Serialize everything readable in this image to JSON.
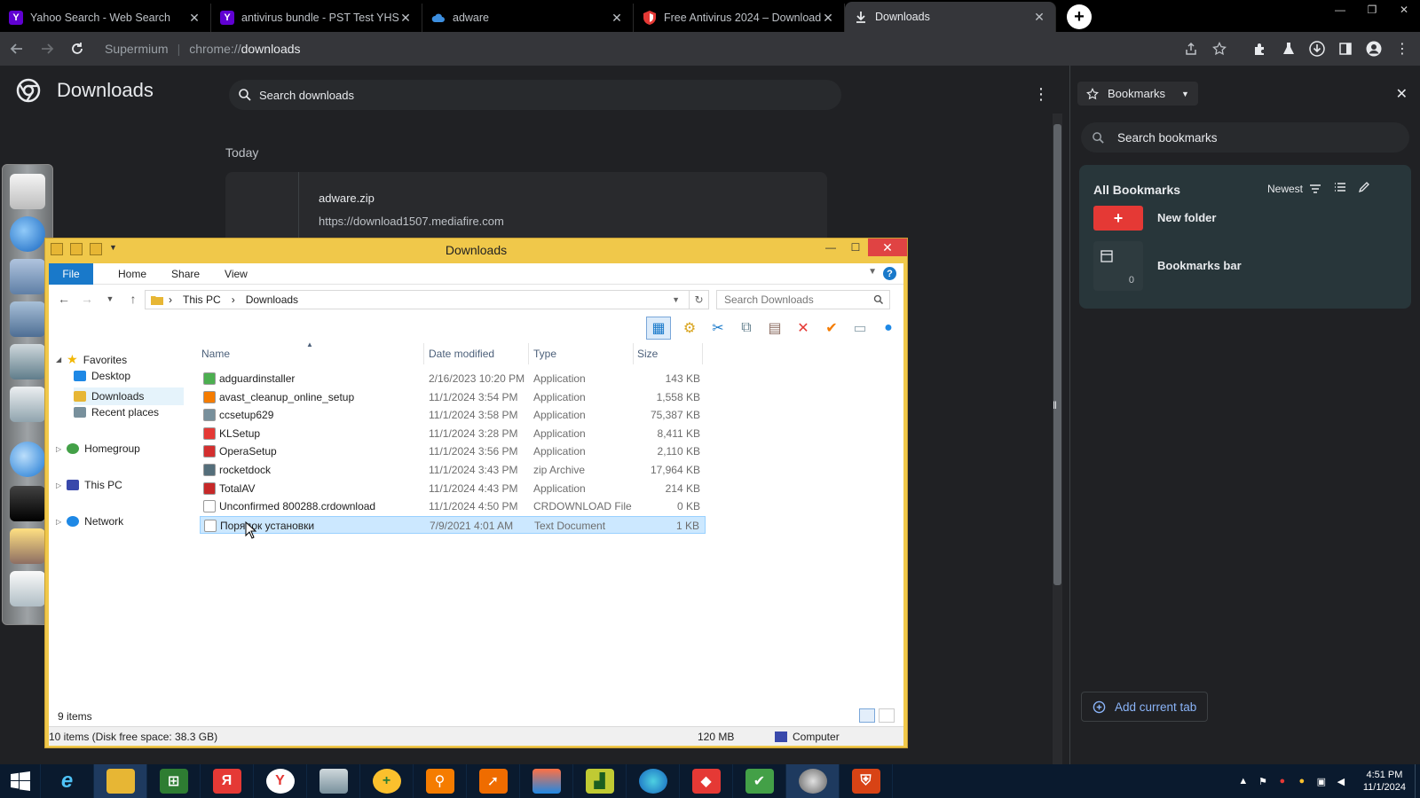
{
  "browser": {
    "tabs": [
      {
        "title": "Yahoo Search - Web Search",
        "favicon_color": "#6001d2",
        "favicon_glyph": "Y",
        "active": false
      },
      {
        "title": "antivirus bundle - PST Test YHS",
        "favicon_color": "#6001d2",
        "favicon_glyph": "Y",
        "active": false
      },
      {
        "title": "adware",
        "favicon_color": "#3d8fe0",
        "favicon_glyph": "",
        "active": false
      },
      {
        "title": "Free Antivirus 2024 – Download",
        "favicon_color": "#e53935",
        "favicon_glyph": "",
        "active": false
      },
      {
        "title": "Downloads",
        "favicon_color": "#e8eaed",
        "favicon_glyph": "",
        "active": true
      }
    ],
    "omnibox": {
      "site": "Supermium",
      "url_prefix": "chrome://",
      "url_path": "downloads"
    }
  },
  "downloads_page": {
    "title": "Downloads",
    "search_placeholder": "Search downloads",
    "date_group": "Today",
    "item": {
      "name": "adware.zip",
      "url": "https://download1507.mediafire.com"
    }
  },
  "bookmarks_panel": {
    "header": "Bookmarks",
    "search_placeholder": "Search bookmarks",
    "section_title": "All Bookmarks",
    "sort_label": "Newest",
    "new_folder_label": "New folder",
    "bookmarks_bar_label": "Bookmarks bar",
    "bookmarks_bar_count": "0",
    "add_current_tab": "Add current tab"
  },
  "explorer": {
    "title": "Downloads",
    "ribbon_tabs": [
      "File",
      "Home",
      "Share",
      "View"
    ],
    "breadcrumb": [
      "This PC",
      "Downloads"
    ],
    "search_placeholder": "Search Downloads",
    "nav": {
      "favorites": "Favorites",
      "desktop": "Desktop",
      "downloads": "Downloads",
      "recent": "Recent places",
      "homegroup": "Homegroup",
      "thispc": "This PC",
      "network": "Network"
    },
    "columns": {
      "name": "Name",
      "date": "Date modified",
      "type": "Type",
      "size": "Size"
    },
    "files": [
      {
        "name": "adguardinstaller",
        "date": "2/16/2023 10:20 PM",
        "type": "Application",
        "size": "143 KB",
        "color": "#4caf50"
      },
      {
        "name": "avast_cleanup_online_setup",
        "date": "11/1/2024 3:54 PM",
        "type": "Application",
        "size": "1,558 KB",
        "color": "#f57c00"
      },
      {
        "name": "ccsetup629",
        "date": "11/1/2024 3:58 PM",
        "type": "Application",
        "size": "75,387 KB",
        "color": "#78909c"
      },
      {
        "name": "KLSetup",
        "date": "11/1/2024 3:28 PM",
        "type": "Application",
        "size": "8,411 KB",
        "color": "#e53935"
      },
      {
        "name": "OperaSetup",
        "date": "11/1/2024 3:56 PM",
        "type": "Application",
        "size": "2,110 KB",
        "color": "#d32f2f"
      },
      {
        "name": "rocketdock",
        "date": "11/1/2024 3:43 PM",
        "type": "zip Archive",
        "size": "17,964 KB",
        "color": "#546e7a"
      },
      {
        "name": "TotalAV",
        "date": "11/1/2024 4:43 PM",
        "type": "Application",
        "size": "214 KB",
        "color": "#c62828"
      },
      {
        "name": "Unconfirmed 800288.crdownload",
        "date": "11/1/2024 4:50 PM",
        "type": "CRDOWNLOAD File",
        "size": "0 KB",
        "color": "#ffffff"
      },
      {
        "name": "Порядок установки",
        "date": "7/9/2021 4:01 AM",
        "type": "Text Document",
        "size": "1 KB",
        "color": "#ffffff"
      }
    ],
    "item_count": "9 items",
    "status_left": "10 items (Disk free space: 38.3 GB)",
    "status_size": "120 MB",
    "status_location": "Computer"
  },
  "taskbar": {
    "clock_time": "4:51 PM",
    "clock_date": "11/1/2024"
  }
}
